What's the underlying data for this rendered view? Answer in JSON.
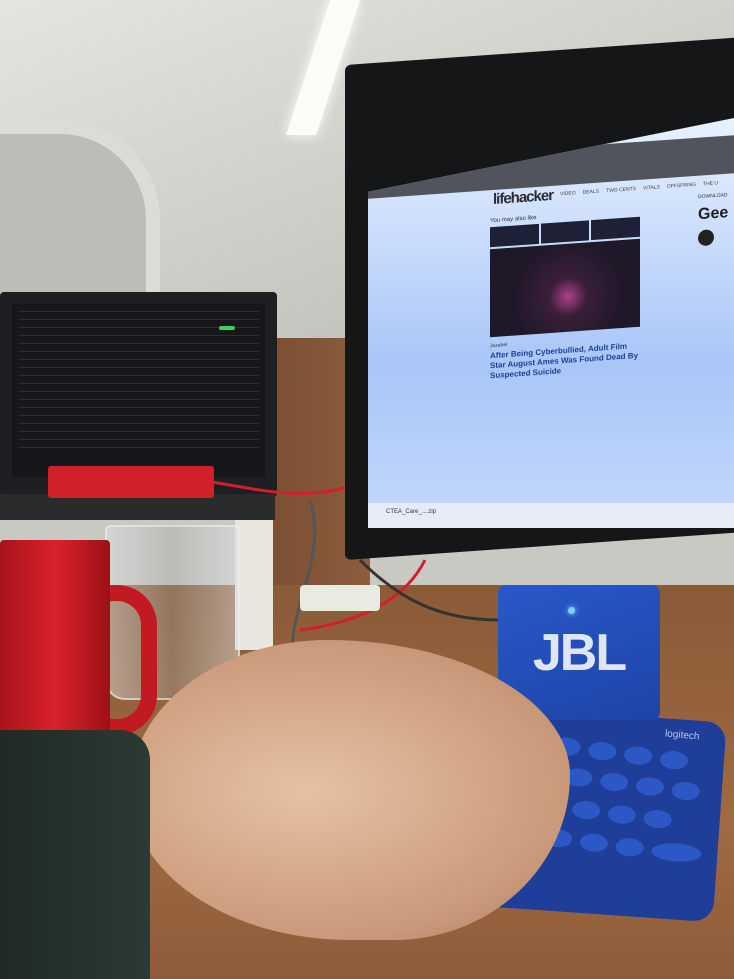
{
  "monitor": {
    "site_logo": "lifehacker",
    "nav_items": [
      "VIDEO",
      "DEALS",
      "TWO CENTS",
      "VITALS",
      "OFFSPRING",
      "THE U"
    ],
    "section_label": "You may also like",
    "article_source": "Jezebel",
    "article_headline": "After Being Cyberbullied, Adult Film Star August Ames Was Found Dead By Suspected Suicide",
    "sidebar_label": "DOWNLOAD",
    "sidebar_heading": "Gee",
    "download_file": "CTEA_Care_....zip"
  },
  "speaker": {
    "brand": "JBL"
  },
  "keyboard": {
    "brand": "logitech"
  },
  "colors": {
    "speaker": "#2a58c8",
    "mug": "#d9222a",
    "keyboard": "#1e3e9a"
  }
}
